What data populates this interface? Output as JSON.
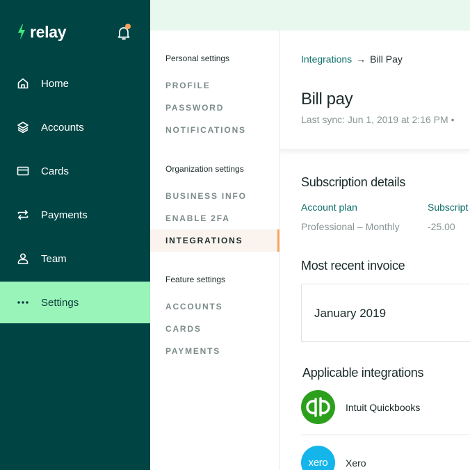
{
  "brand": {
    "name": "relay",
    "accent": "#98f4b8",
    "sidebar_bg": "#004444",
    "notification_color": "#f6a35b"
  },
  "sidebar": {
    "items": [
      {
        "label": "Home",
        "icon": "home-icon"
      },
      {
        "label": "Accounts",
        "icon": "layers-icon"
      },
      {
        "label": "Cards",
        "icon": "card-icon"
      },
      {
        "label": "Payments",
        "icon": "swap-arrows-icon"
      },
      {
        "label": "Team",
        "icon": "person-icon"
      },
      {
        "label": "Settings",
        "icon": "more-dots-icon",
        "active": true
      }
    ]
  },
  "settings_nav": {
    "personal": {
      "title": "Personal settings",
      "links": [
        "PROFILE",
        "PASSWORD",
        "NOTIFICATIONS"
      ]
    },
    "organization": {
      "title": "Organization settings",
      "links": [
        "BUSINESS INFO",
        "ENABLE 2FA",
        "INTEGRATIONS"
      ],
      "active": "INTEGRATIONS"
    },
    "feature": {
      "title": "Feature settings",
      "links": [
        "ACCOUNTS",
        "CARDS",
        "PAYMENTS"
      ]
    }
  },
  "main": {
    "breadcrumb": {
      "parent": "Integrations",
      "current": "Bill Pay"
    },
    "title": "Bill pay",
    "last_sync": "Last sync: Jun 1, 2019 at 2:16 PM  •",
    "subscription": {
      "heading": "Subscription details",
      "account_plan_label": "Account plan",
      "account_plan_value": "Professional – Monthly",
      "subscription_label": "Subscript",
      "subscription_value": "-25.00"
    },
    "invoice": {
      "heading": "Most recent invoice",
      "month": "January 2019"
    },
    "integrations": {
      "heading": "Applicable integrations",
      "items": [
        {
          "name": "Intuit Quickbooks",
          "icon": "quickbooks-logo-icon",
          "color": "#2ca01c"
        },
        {
          "name": "Xero",
          "logo_text": "xero",
          "icon": "xero-logo-icon",
          "color": "#13b5ea"
        }
      ]
    }
  }
}
